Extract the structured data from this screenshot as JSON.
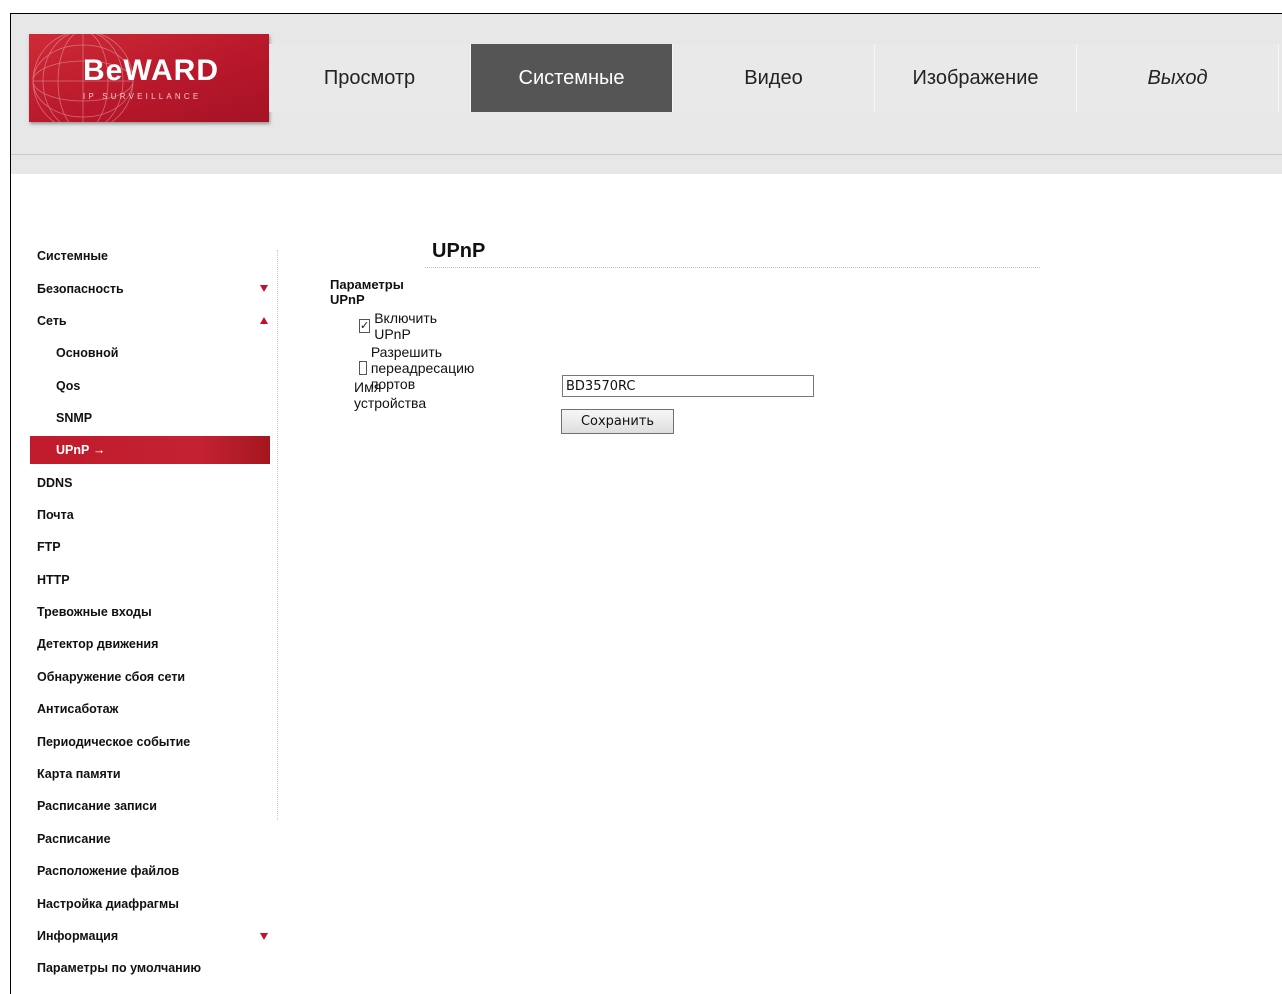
{
  "brand": {
    "logo_text": "BeWARD",
    "logo_subtitle": "IP SURVEILLANCE",
    "brand_color": "#c8102e"
  },
  "nav": {
    "items": [
      {
        "label": "Просмотр"
      },
      {
        "label": "Системные"
      },
      {
        "label": "Видео"
      },
      {
        "label": "Изображение"
      },
      {
        "label": "Выход"
      }
    ],
    "active_index": 1
  },
  "sidebar": {
    "items": [
      {
        "label": "Системные"
      },
      {
        "label": "Безопасность",
        "arrow": "down"
      },
      {
        "label": "Сеть",
        "arrow": "up"
      },
      {
        "label": "Основной"
      },
      {
        "label": "Qos"
      },
      {
        "label": "SNMP"
      },
      {
        "label": "UPnP",
        "arrow_text": "→"
      },
      {
        "label": "DDNS"
      },
      {
        "label": "Почта"
      },
      {
        "label": "FTP"
      },
      {
        "label": "HTTP"
      },
      {
        "label": "Тревожные входы"
      },
      {
        "label": "Детектор движения"
      },
      {
        "label": "Обнаружение сбоя сети"
      },
      {
        "label": "Антисаботаж"
      },
      {
        "label": "Периодическое событие"
      },
      {
        "label": "Карта памяти"
      },
      {
        "label": "Расписание записи"
      },
      {
        "label": "Расписание"
      },
      {
        "label": "Расположение файлов"
      },
      {
        "label": "Настройка диафрагмы"
      },
      {
        "label": "Информация",
        "arrow": "down"
      },
      {
        "label": "Параметры по умолчанию"
      }
    ]
  },
  "main": {
    "title": "UPnP",
    "section_title": "Параметры UPnP",
    "enable_upnp": {
      "label": "Включить UPnP",
      "checked": true
    },
    "port_forwarding": {
      "label": "Разрешить переадресацию портов",
      "checked": false
    },
    "device_name": {
      "label": "Имя устройства",
      "value": "BD3570RC"
    },
    "save_label": "Сохранить"
  }
}
